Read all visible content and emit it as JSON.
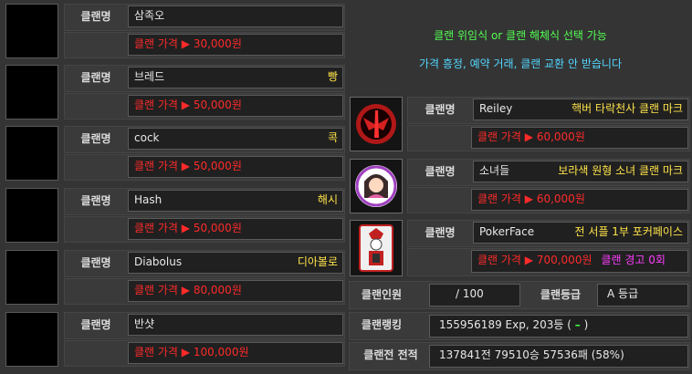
{
  "label_clan_name": "클랜명",
  "left_clans": [
    {
      "name": "삼족오",
      "mark": "",
      "price": "클랜 가격 ▶ 30,000원"
    },
    {
      "name": "브레드",
      "mark": "빵",
      "price": "클랜 가격 ▶ 50,000원"
    },
    {
      "name": "cock",
      "mark": "콕",
      "price": "클랜 가격 ▶ 50,000원"
    },
    {
      "name": "Hash",
      "mark": "해시",
      "price": "클랜 가격 ▶ 50,000원"
    },
    {
      "name": "Diabolus",
      "mark": "디아볼로",
      "price": "클랜 가격 ▶ 80,000원"
    },
    {
      "name": "반샷",
      "mark": "",
      "price": "클랜 가격 ▶ 100,000원"
    }
  ],
  "notice": {
    "line1": "클랜 위임식 or 클랜 해체식 선택 가능",
    "line2": "가격 흥정, 예약 거래, 클랜 교환 안 받습니다"
  },
  "right_clans": [
    {
      "name": "Reiley",
      "mark": "핵버 타락천사 클랜 마크",
      "price": "클랜 가격 ▶ 60,000원",
      "extra": "",
      "icon": "fallen-angel-emblem"
    },
    {
      "name": "소녀들",
      "mark": "보라색 원형 소녀 클랜 마크",
      "price": "클랜 가격 ▶ 60,000원",
      "extra": "",
      "icon": "girl-emblem"
    },
    {
      "name": "PokerFace",
      "mark": "전 서플 1부 포커페이스",
      "price": "클랜 가격 ▶ 700,000원",
      "extra": "클랜 경고 0회",
      "icon": "joker-card-emblem"
    }
  ],
  "stats": {
    "members_label": "클랜인원",
    "members_value": "/ 100",
    "grade_label": "클랜등급",
    "grade_value": "A 등급",
    "ranking_label": "클랜랭킹",
    "ranking_value": "155956189 Exp,  203등 (",
    "ranking_dash": "–",
    "ranking_close": ")",
    "record_label": "클랜전 전적",
    "record_value": "137841전 79510승 57536패 (58%)"
  },
  "colors": {
    "price": "#ff2a2a",
    "mark": "#ffe34a",
    "warning": "#ff3cff",
    "notice_green": "#53ff53",
    "notice_cyan": "#53d6ff"
  }
}
